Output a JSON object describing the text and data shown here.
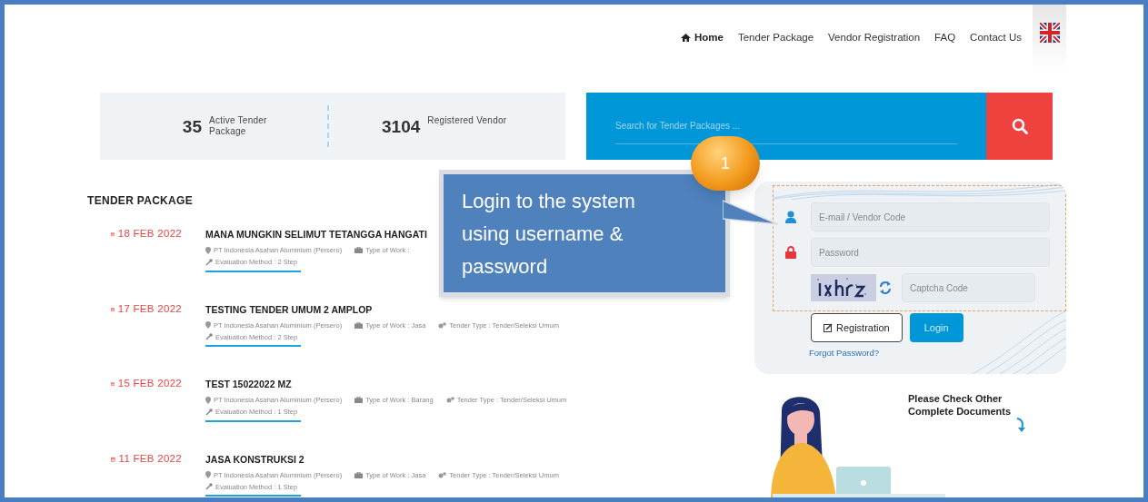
{
  "nav": {
    "items": [
      {
        "label": "Home",
        "selected": true
      },
      {
        "label": "Tender Package",
        "selected": false
      },
      {
        "label": "Vendor Registration",
        "selected": false
      },
      {
        "label": "FAQ",
        "selected": false
      },
      {
        "label": "Contact Us",
        "selected": false
      }
    ]
  },
  "stats": [
    {
      "value": "35",
      "label": "Active Tender Package"
    },
    {
      "value": "3104",
      "label": "Registered Vendor"
    }
  ],
  "search": {
    "placeholder": "Search for Tender Packages ..."
  },
  "tender_package": {
    "title": "TENDER PACKAGE",
    "items": [
      {
        "date": "18 FEB 2022",
        "title": "MANA MUNGKIN SELIMUT TETANGGA HANGATI",
        "company": "PT Indonesia Asahan Aluminium (Persero)",
        "type_of_work": "Type of Work :",
        "evaluation": "Evaluation Method : 2 Step"
      },
      {
        "date": "17 FEB 2022",
        "title": "TESTING TENDER UMUM 2 AMPLOP",
        "company": "PT Indonesia Asahan Aluminium (Persero)",
        "type_of_work": "Type of Work : Jasa",
        "tender_type": "Tender Type : Tender/Seleksi Umum",
        "evaluation": "Evaluation Method : 2 Step"
      },
      {
        "date": "15 FEB 2022",
        "title": "TEST 15022022 MZ",
        "company": "PT Indonesia Asahan Aluminium (Persero)",
        "type_of_work": "Type of Work : Barang",
        "tender_type": "Tender Type : Tender/Seleksi Umum",
        "evaluation": "Evaluation Method : 1 Step"
      },
      {
        "date": "11 FEB 2022",
        "title": "JASA KONSTRUKSI 2",
        "company": "PT Indonesia Asahan Aluminium (Persero)",
        "type_of_work": "Type of Work : Jasa",
        "tender_type": "Tender Type : Tender/Seleksi Umum",
        "evaluation": "Evaluation Method : 1 Step"
      }
    ]
  },
  "login": {
    "email_placeholder": "E-mail / Vendor Code",
    "password_placeholder": "Password",
    "captcha_placeholder": "Captcha Code",
    "registration_button": "Registration",
    "login_button": "Login",
    "forgot_link": "Forgot Password?"
  },
  "callout": {
    "number": "1",
    "text": "Login to the system using username & password"
  },
  "documents_note": "Please Check Other Complete Documents"
}
